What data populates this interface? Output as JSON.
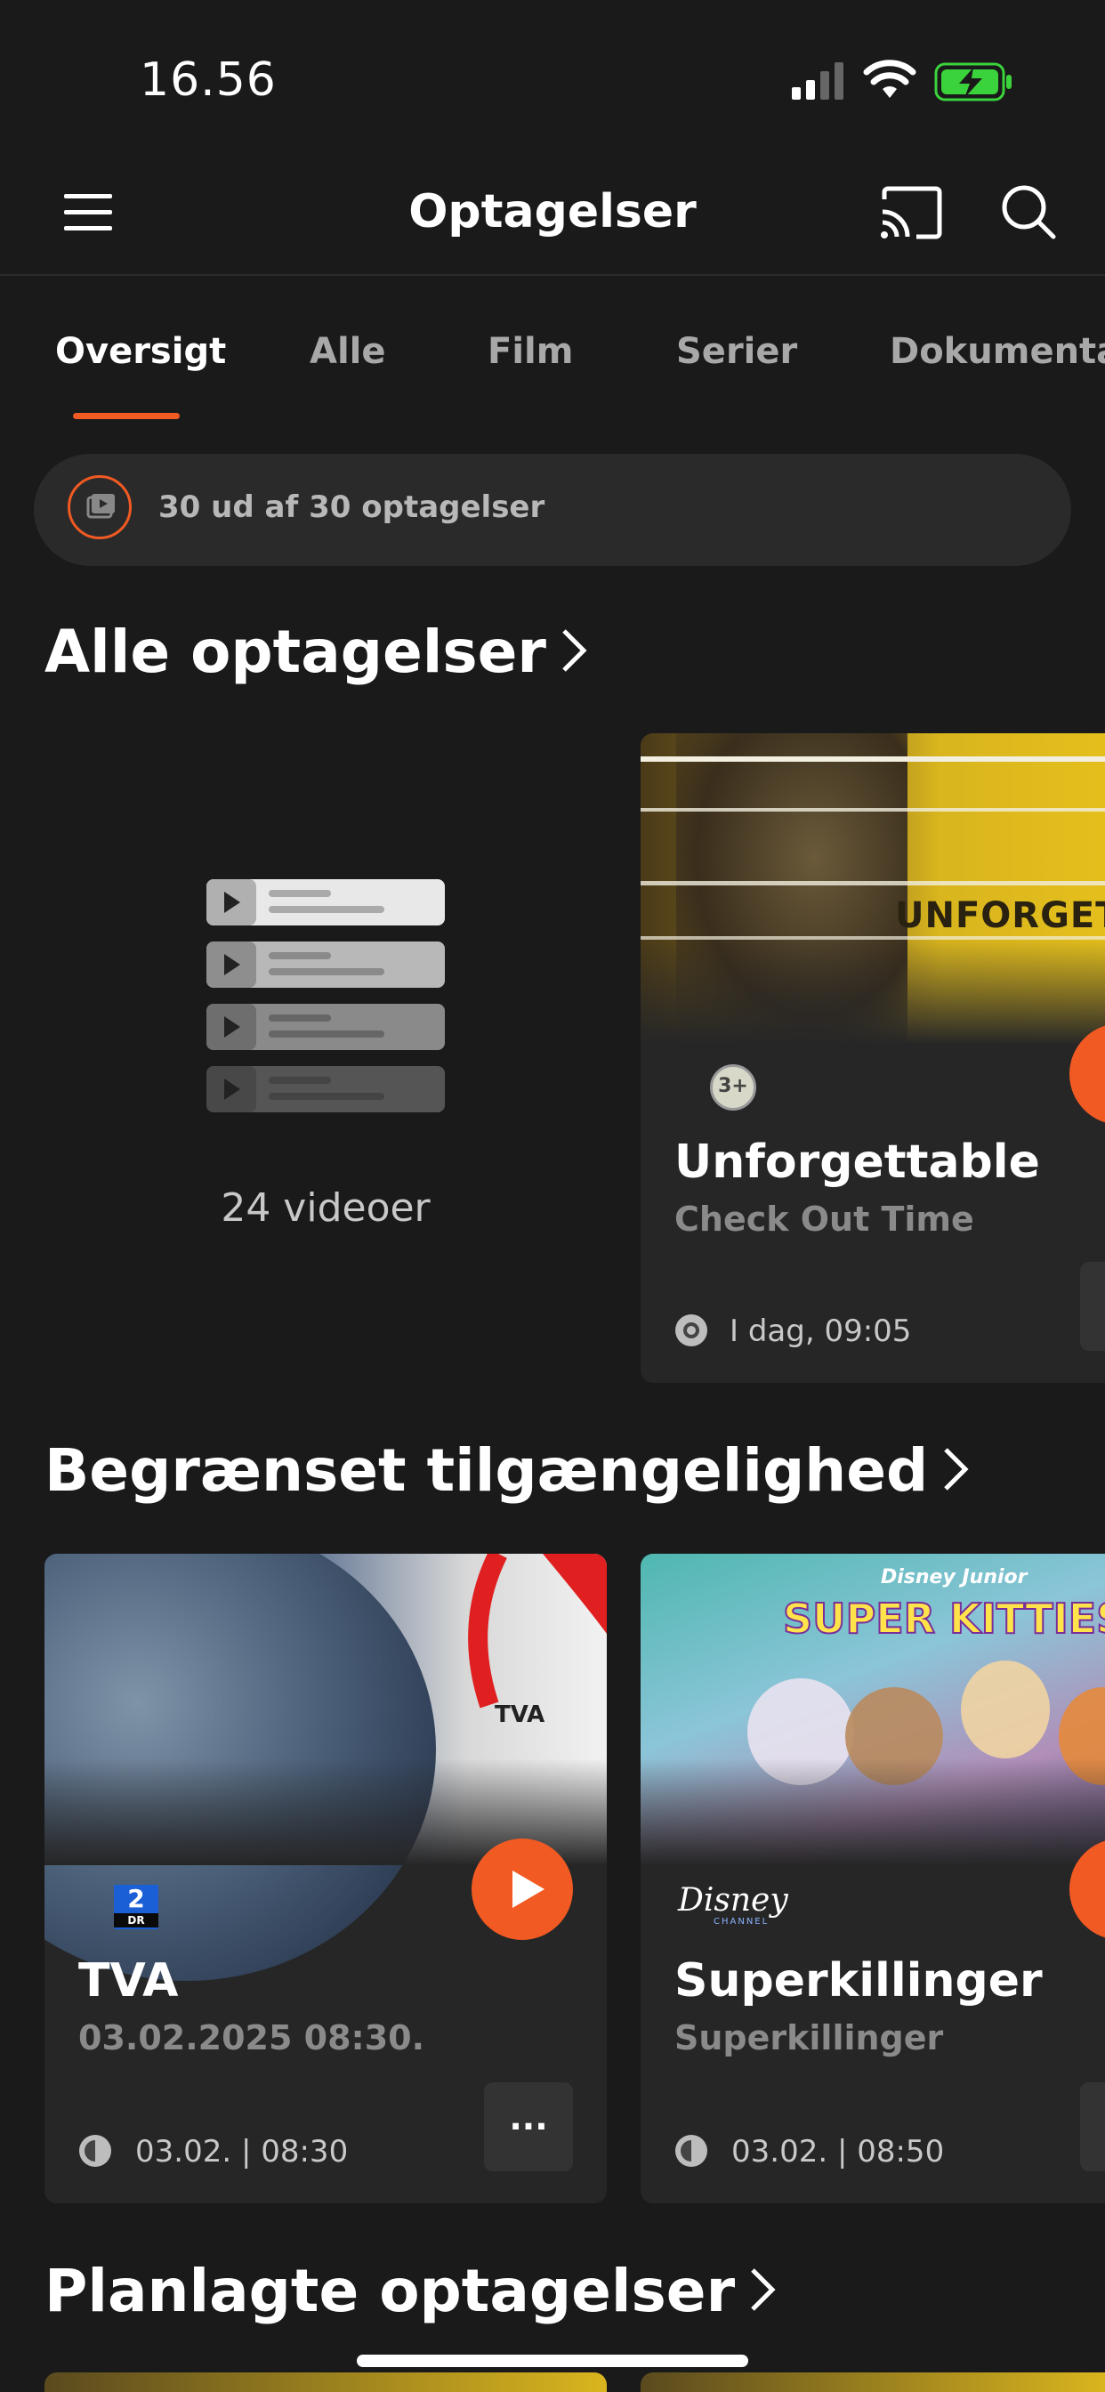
{
  "status_bar": {
    "time": "16.56"
  },
  "header": {
    "title": "Optagelser"
  },
  "tabs": [
    {
      "label": "Oversigt"
    },
    {
      "label": "Alle"
    },
    {
      "label": "Film"
    },
    {
      "label": "Serier"
    },
    {
      "label": "Dokumentar"
    }
  ],
  "summary": {
    "text": "30 ud af 30 optagelser"
  },
  "sections": {
    "all": {
      "title": "Alle optagelser",
      "videos_count_label": "24 videoer"
    },
    "limited": {
      "title": "Begrænset tilgængelighed"
    },
    "planned": {
      "title": "Planlagte optagelser"
    }
  },
  "cards": {
    "unforgettable": {
      "image_text": "UNFORGETTA",
      "channel_logo": "3+",
      "title": "Unforgettable",
      "subtitle": "Check Out Time",
      "meta": "I dag, 09:05"
    },
    "tva": {
      "image_text": "TVA",
      "channel_logo": "DR 2",
      "channel_logo_number": "2",
      "channel_logo_text": "DR",
      "title": "TVA",
      "subtitle": "03.02.2025 08:30.",
      "meta": "03.02. | 08:30",
      "more_label": "..."
    },
    "superkillinger": {
      "image_brand": "Disney Junior",
      "image_title": "SUPER KITTIES",
      "channel_logo": "Disney CHANNEL",
      "channel_logo_name": "Disney",
      "channel_logo_sub": "CHANNEL",
      "title": "Superkillinger",
      "subtitle": "Superkillinger",
      "meta": "03.02. | 08:50"
    }
  },
  "colors": {
    "accent": "#f15a22",
    "background": "#1a1a1b",
    "card": "#262627"
  }
}
